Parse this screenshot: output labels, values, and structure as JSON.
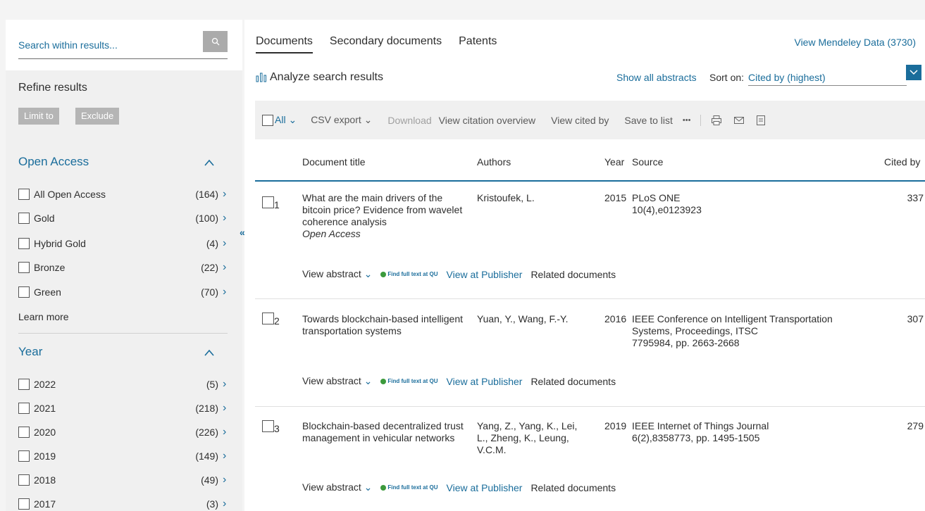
{
  "sidebar": {
    "search_placeholder": "Search within results...",
    "refine_title": "Refine results",
    "limit_label": "Limit to",
    "exclude_label": "Exclude",
    "open_access_title": "Open Access",
    "open_access": [
      {
        "label": "All Open Access",
        "count": "(164)"
      },
      {
        "label": "Gold",
        "count": "(100)"
      },
      {
        "label": "Hybrid Gold",
        "count": "(4)"
      },
      {
        "label": "Bronze",
        "count": "(22)"
      },
      {
        "label": "Green",
        "count": "(70)"
      }
    ],
    "learn_more": "Learn more",
    "year_title": "Year",
    "years": [
      {
        "label": "2022",
        "count": "(5)"
      },
      {
        "label": "2021",
        "count": "(218)"
      },
      {
        "label": "2020",
        "count": "(226)"
      },
      {
        "label": "2019",
        "count": "(149)"
      },
      {
        "label": "2018",
        "count": "(49)"
      },
      {
        "label": "2017",
        "count": "(3)"
      }
    ]
  },
  "main": {
    "tabs": [
      "Documents",
      "Secondary documents",
      "Patents"
    ],
    "mendeley": "View Mendeley Data (3730)",
    "analyze": "Analyze search results",
    "show_abstracts": "Show all abstracts",
    "sort_label": "Sort on:",
    "sort_value": "Cited by (highest)",
    "toolbar": {
      "all": "All",
      "csv": "CSV export",
      "download": "Download",
      "citation": "View citation overview",
      "cited_by": "View cited by",
      "save": "Save to list",
      "more": "•••"
    },
    "headers": {
      "title": "Document title",
      "authors": "Authors",
      "year": "Year",
      "source": "Source",
      "cited": "Cited by"
    },
    "rows": [
      {
        "num": "1",
        "title": "What are the main drivers of the bitcoin price? Evidence from wavelet coherence analysis",
        "access": "Open Access",
        "authors": "Kristoufek, L.",
        "year": "2015",
        "source1": "PLoS ONE",
        "source2": "10(4),e0123923",
        "cited": "337"
      },
      {
        "num": "2",
        "title": "Towards blockchain-based intelligent transportation systems",
        "access": "",
        "authors": "Yuan, Y., Wang, F.-Y.",
        "year": "2016",
        "source1": "IEEE Conference on Intelligent Transportation Systems, Proceedings, ITSC",
        "source2": "7795984, pp. 2663-2668",
        "cited": "307"
      },
      {
        "num": "3",
        "title": "Blockchain-based decentralized trust management in vehicular networks",
        "access": "",
        "authors": "Yang, Z., Yang, K., Lei, L., Zheng, K., Leung, V.C.M.",
        "year": "2019",
        "source1": "IEEE Internet of Things Journal",
        "source2": "6(2),8358773, pp. 1495-1505",
        "cited": "279"
      }
    ],
    "actions": {
      "view_abstract": "View abstract",
      "find_full": "Find full text at QU",
      "publisher": "View at Publisher",
      "related": "Related documents"
    }
  }
}
